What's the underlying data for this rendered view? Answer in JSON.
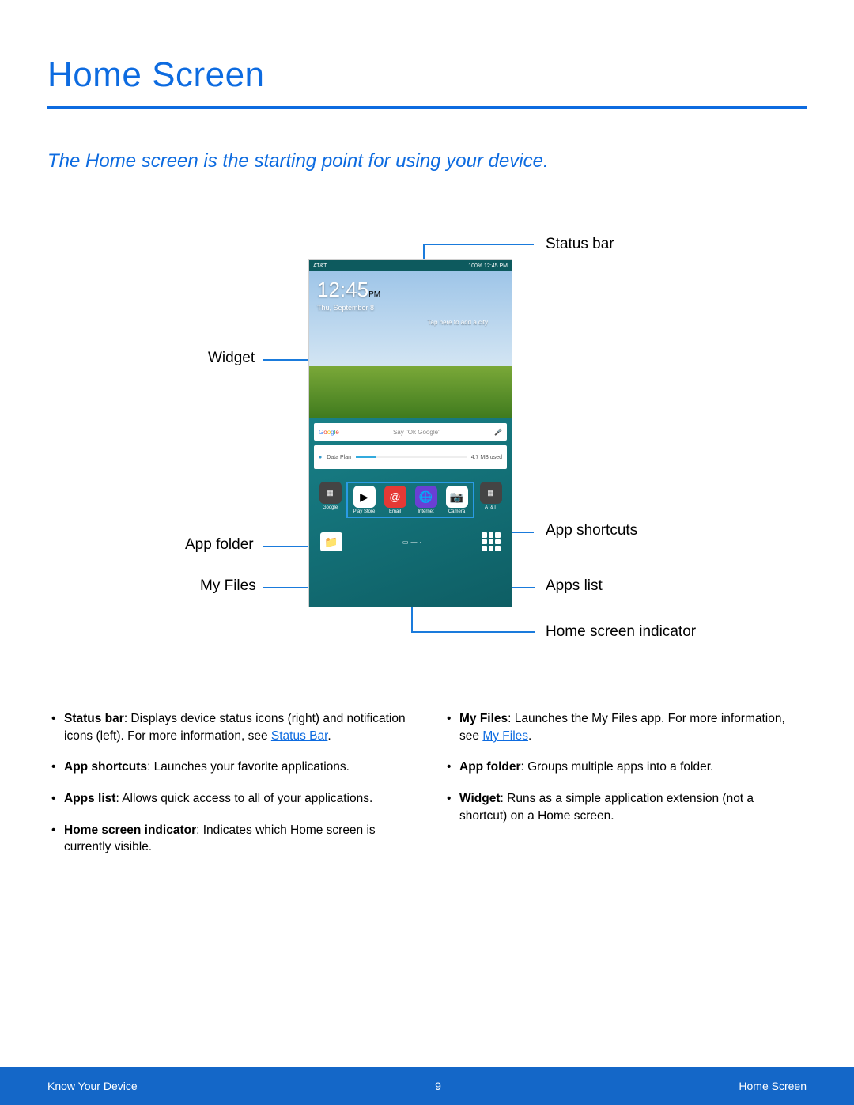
{
  "title": "Home Screen",
  "subtitle": "The Home screen is the starting point for using your device.",
  "callouts": {
    "status_bar": "Status bar",
    "widget": "Widget",
    "app_folder": "App folder",
    "my_files": "My Files",
    "app_shortcuts": "App shortcuts",
    "apps_list": "Apps list",
    "home_indicator": "Home screen indicator"
  },
  "device": {
    "status_left": "AT&T",
    "status_right": "100% 12:45 PM",
    "clock_time": "12:45",
    "clock_suffix": "PM",
    "clock_date": "Thu, September 8",
    "add_city": "Tap here to add a city",
    "google_hint": "Say \"Ok Google\"",
    "dataplan_label": "Data Plan",
    "dataplan_usage": "4.7 MB used",
    "apps": {
      "google": "Google",
      "playstore": "Play Store",
      "email": "Email",
      "internet": "Internet",
      "camera": "Camera",
      "att": "AT&T"
    }
  },
  "desc": {
    "left": [
      {
        "b": "Status bar",
        "t": ": Displays device status icons (right) and notification icons (left). For more information, see ",
        "link": "Status Bar",
        "after": "."
      },
      {
        "b": "App shortcuts",
        "t": ": Launches your favorite applications."
      },
      {
        "b": "Apps list",
        "t": ": Allows quick access to all of your applications."
      },
      {
        "b": "Home screen indicator",
        "t": ": Indicates which Home screen is currently visible."
      }
    ],
    "right": [
      {
        "b": "My Files",
        "t": ": Launches the My Files app. For more information, see ",
        "link": "My Files",
        "after": "."
      },
      {
        "b": "App folder",
        "t": ": Groups multiple apps into a folder."
      },
      {
        "b": "Widget",
        "t": ": Runs as a simple application extension (not a shortcut) on a Home screen."
      }
    ]
  },
  "footer": {
    "left": "Know Your Device",
    "center": "9",
    "right": "Home Screen"
  }
}
